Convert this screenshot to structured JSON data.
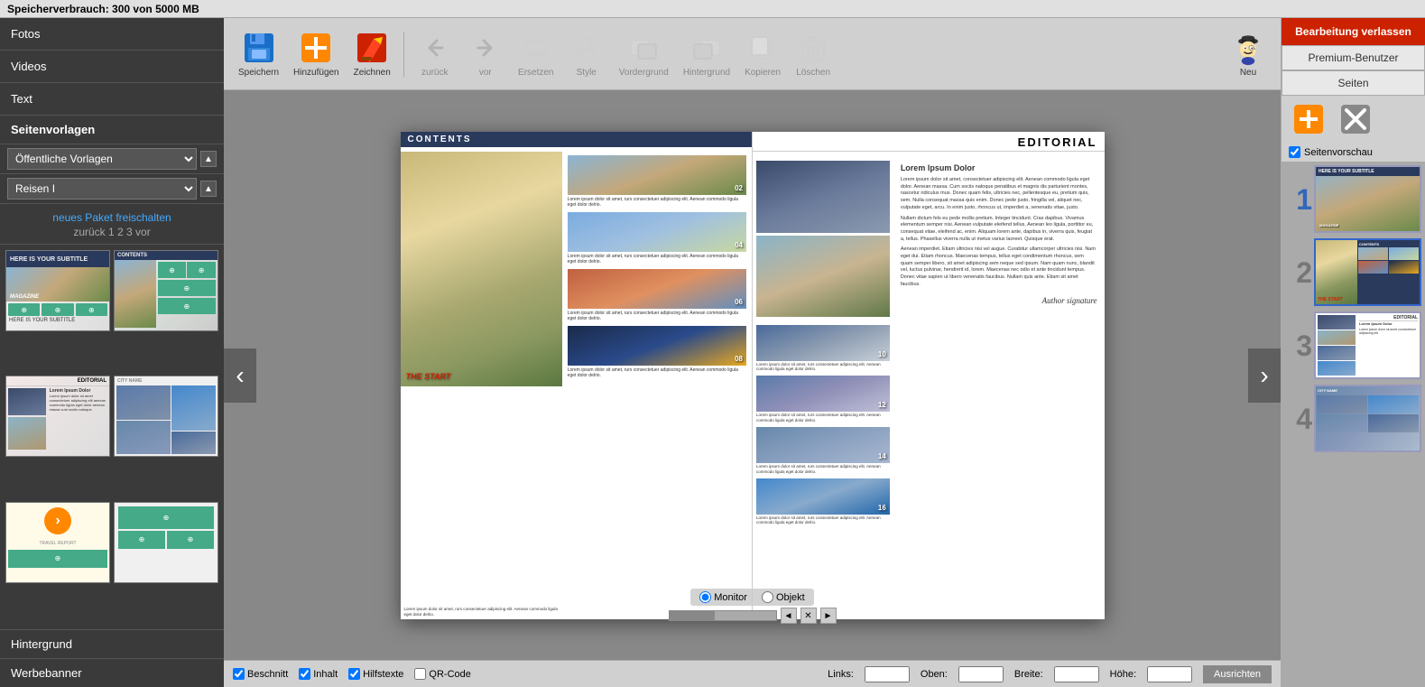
{
  "app": {
    "storage_label": "Speicherverbrauch: 300 von 5000 MB",
    "edit_btn": "Bearbeitung verlassen",
    "premium_btn": "Premium-Benutzer",
    "seiten_btn": "Seiten"
  },
  "sidebar": {
    "fotos": "Fotos",
    "videos": "Videos",
    "text": "Text",
    "seitenvorlagen": "Seitenvorlagen",
    "oeffentliche_vorlagen": "Öffentliche Vorlagen",
    "reisen": "Reisen I",
    "freischalten": "neues Paket freischalten",
    "pagination": "zurück 1 2 3 vor",
    "hintergrund": "Hintergrund",
    "werbebanner": "Werbebanner"
  },
  "toolbar": {
    "speichern": "Speichern",
    "hinzufuegen": "Hinzufügen",
    "zeichnen": "Zeichnen",
    "zurueck": "zurück",
    "vor": "vor",
    "ersetzen": "Ersetzen",
    "style": "Style",
    "vordergrund": "Vordergrund",
    "hintergrund": "Hintergrund",
    "kopieren": "Kopieren",
    "loeschen": "Löschen",
    "neu": "Neu"
  },
  "right_panel": {
    "seitenvorschau": "Seitenvorschau",
    "page_nums": [
      "1",
      "2",
      "3",
      "4"
    ]
  },
  "bottom": {
    "monitor": "Monitor",
    "objekt": "Objekt",
    "beschnitt": "Beschnitt",
    "inhalt": "Inhalt",
    "hilfstexte": "Hilfstexte",
    "qr_code": "QR-Code",
    "links": "Links:",
    "oben": "Oben:",
    "breite": "Breite:",
    "hoehe": "Höhe:",
    "ausrichten": "Ausrichten"
  },
  "pages": {
    "contents_title": "CONTENTS",
    "editorial_title": "EDITORIAL",
    "lorem_short": "Lorem ipsum dolor sit amet, rurs consectetuer adipiscing elit. Aenean commodo ligula eget dolor delrio.",
    "lorem_long": "Lorem ipsum dolor sit amet, consectetuer adipiscing elit. Aenean commodo ligula eget dolor. Aenean massa. Cum sociis natoque penatibus et magnis dis parturient montes, nascetur ridiculus mus. Donec quam felis, ultricies nec, pellentesque eu, pretium quis, sem. Nulla consequat massa quis enim. Donec pede justo, fringilla vel, aliquet nec, vulputate eget, arcu. In enim justo, rhoncus ut, imperdiet a, venenatis vitae, justo.",
    "lorem_long2": "Nullam dictum fels eu pede mollis pretium. Integer tincidunt. Cras dapibus. Vivamus elementum semper nisi. Aenean vulputate eleifend tellus. Aenean leo ligula, porttitor eu, consequat vitae, eleifend ac, enim. Aliquam lorem ante, dapibus in, viverra quis, feugiat a, tellus. Phasellus viverra nulla ut metus varius laoreet. Quisque erat.",
    "lorem_long3": "Aenean imperdiet. Etiam ultricies nisi vel augue. Curabitur ullamcorper ultricies nisi. Nam eget dui. Etiam rhoncus. Maecenas tempus, tellus eget condimentum rhoncus, sem quam semper libero, sit amet adipiscing sem neque sed ipsum. Nam quam nunc, blandit vel, luctus pulvinar, hendrerit id, lorem. Maecenas nec odio et ante tincidunt tempus. Donec vitae sapien ut libero venenatis faucibus. Nullam quis ante. Etiam sit amet faucibus.",
    "author_sig": "Author signature",
    "items": [
      {
        "num": "02",
        "text": "Lorem ipsum dolor sit amet, rurs consectetuer adipiscing elit. Aenean commodo ligula eget dolor delrio."
      },
      {
        "num": "04",
        "text": "Lorem ipsum dolor sit amet, rurs consectetuer adipiscing elit. Aenean commodo ligula eget dolor delrio."
      },
      {
        "num": "06",
        "text": "Lorem ipsum dolor sit amet, rurs consectetuer adipiscing elit. Aenean commodo ligula eget dolor delrio."
      },
      {
        "num": "08",
        "text": "Lorem ipsum dolor sit amet, rurs consectetuer adipiscing elit. Aenean commodo ligula eget dolor delrio."
      },
      {
        "num": "10",
        "text": "Lorem ipsum dolor sit amet, rurs consectetuer adipiscing elit. Aenean commodo ligula eget dolor delrio."
      },
      {
        "num": "12",
        "text": "Lorem ipsum dolor sit amet, rurs consectetuer adipiscing elit. Aenean commodo ligula eget dolor delrio."
      },
      {
        "num": "14",
        "text": "Lorem ipsum dolor sit amet, rurs consectetuer adipiscing elit. Aenean commodo ligula eget dolor delrio."
      },
      {
        "num": "16",
        "text": "Lorem ipsum dolor sit amet, rurs consectetuer adipiscing elit. Aenean commodo ligula eget dolor delrio."
      }
    ],
    "start_label": "THE START",
    "lorem_ipsum_dolor": "Lorem Ipsum Dolor"
  }
}
